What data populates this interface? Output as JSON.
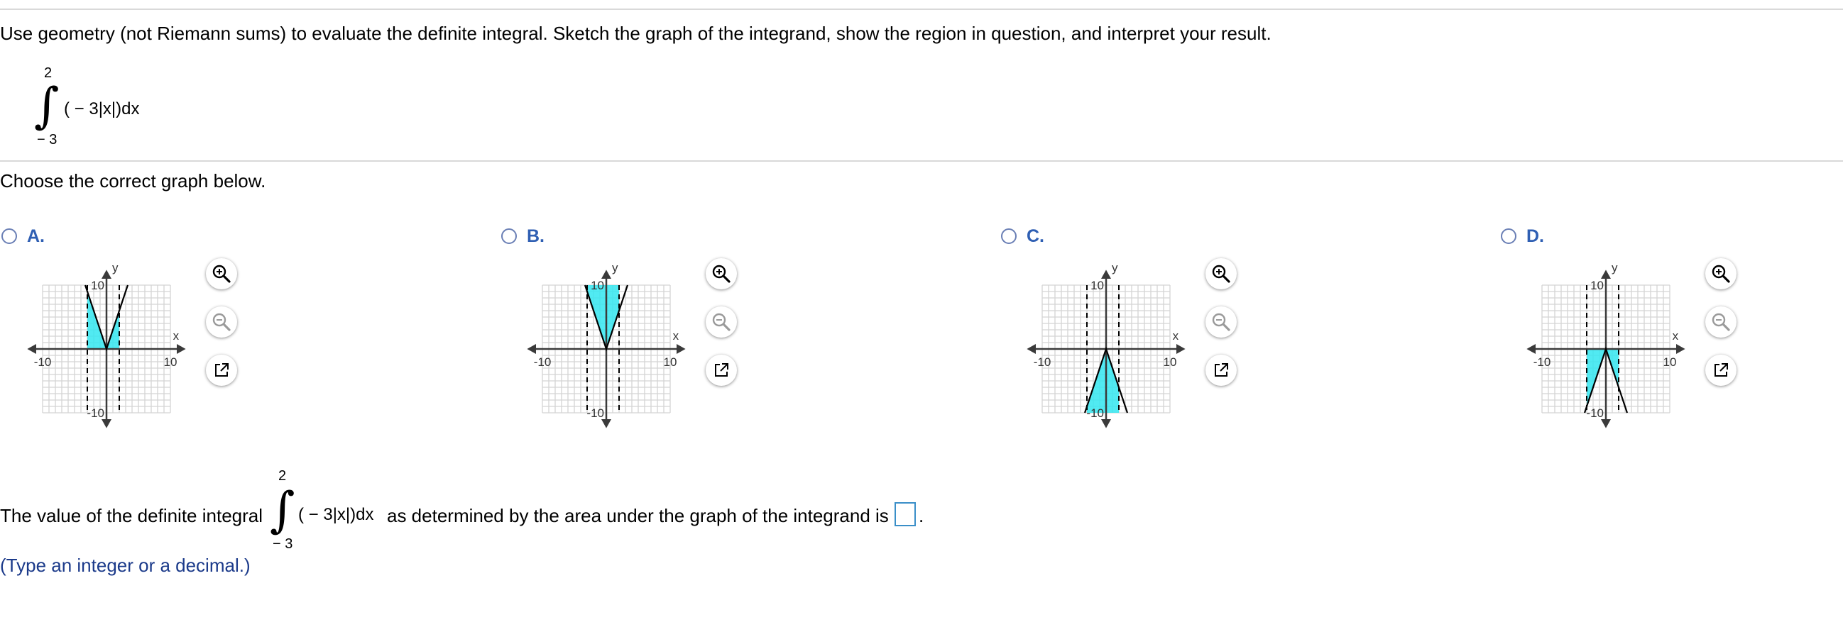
{
  "question": {
    "instruction": "Use geometry (not Riemann sums) to evaluate the definite integral. Sketch the graph of the integrand, show the region in question, and interpret your result.",
    "integral": {
      "upper": "2",
      "lower": "− 3",
      "sign": "∫",
      "expression": "( − 3|x|)dx"
    }
  },
  "choose_prompt": "Choose the correct graph below.",
  "options": [
    {
      "label": "A.",
      "selected": false
    },
    {
      "label": "B.",
      "selected": false
    },
    {
      "label": "C.",
      "selected": false
    },
    {
      "label": "D.",
      "selected": false
    }
  ],
  "graph_axes": {
    "x_label": "x",
    "y_label": "y",
    "x_min_label": "-10",
    "x_max_label": "10",
    "y_max_label": "10",
    "y_min_label": "-10"
  },
  "chart_data": [
    {
      "type": "line",
      "option": "A",
      "x": [
        -10,
        10
      ],
      "xlim": [
        -10,
        10
      ],
      "ylim": [
        -10,
        10
      ],
      "function": "3|x|",
      "series": [
        {
          "x": [
            -3.33,
            0,
            3.33
          ],
          "y": [
            10,
            0,
            10
          ]
        }
      ],
      "shaded_region": {
        "x_from": -3,
        "x_to": 2,
        "between": "curve and x-axis",
        "side": "above x-axis"
      },
      "dashed_verticals": [
        -3,
        2
      ],
      "shade_color": "#33e6f0"
    },
    {
      "type": "line",
      "option": "B",
      "xlim": [
        -10,
        10
      ],
      "ylim": [
        -10,
        10
      ],
      "function": "3|x|",
      "series": [
        {
          "x": [
            -3.33,
            0,
            3.33
          ],
          "y": [
            10,
            0,
            10
          ]
        }
      ],
      "shaded_region": {
        "x_from": -3,
        "x_to": 2,
        "between": "curve and y=10",
        "side": "above curve"
      },
      "dashed_verticals": [
        -3,
        2
      ],
      "shade_color": "#33e6f0"
    },
    {
      "type": "line",
      "option": "C",
      "xlim": [
        -10,
        10
      ],
      "ylim": [
        -10,
        10
      ],
      "function": "-3|x|",
      "series": [
        {
          "x": [
            -3.33,
            0,
            3.33
          ],
          "y": [
            -10,
            0,
            -10
          ]
        }
      ],
      "shaded_region": {
        "x_from": -3,
        "x_to": 2,
        "between": "curve and y=-10",
        "side": "below curve"
      },
      "dashed_verticals": [
        -3,
        2
      ],
      "shade_color": "#33e6f0"
    },
    {
      "type": "line",
      "option": "D",
      "xlim": [
        -10,
        10
      ],
      "ylim": [
        -10,
        10
      ],
      "function": "-3|x|",
      "series": [
        {
          "x": [
            -3.33,
            0,
            3.33
          ],
          "y": [
            -10,
            0,
            -10
          ]
        }
      ],
      "shaded_region": {
        "x_from": -3,
        "x_to": 2,
        "between": "curve and x-axis",
        "side": "below x-axis"
      },
      "dashed_verticals": [
        -3,
        2
      ],
      "shade_color": "#33e6f0"
    }
  ],
  "tools": {
    "zoom_in": "zoom-in-icon",
    "zoom_out": "zoom-out-icon",
    "popout": "popout-icon"
  },
  "answer": {
    "prefix": "The value of the definite integral",
    "integral": {
      "upper": "2",
      "lower": "− 3",
      "sign": "∫",
      "expression": "( − 3|x|)dx"
    },
    "suffix": "as determined by the area under the graph of the integrand is",
    "value": "",
    "end": "."
  },
  "hint": "(Type an integer or a decimal.)",
  "colors": {
    "radio": "#6a7fb5",
    "label": "#2f5fb3",
    "hint": "#1b3a8a",
    "answer_border": "#3a8fc8",
    "shade": "#33e6f0"
  }
}
